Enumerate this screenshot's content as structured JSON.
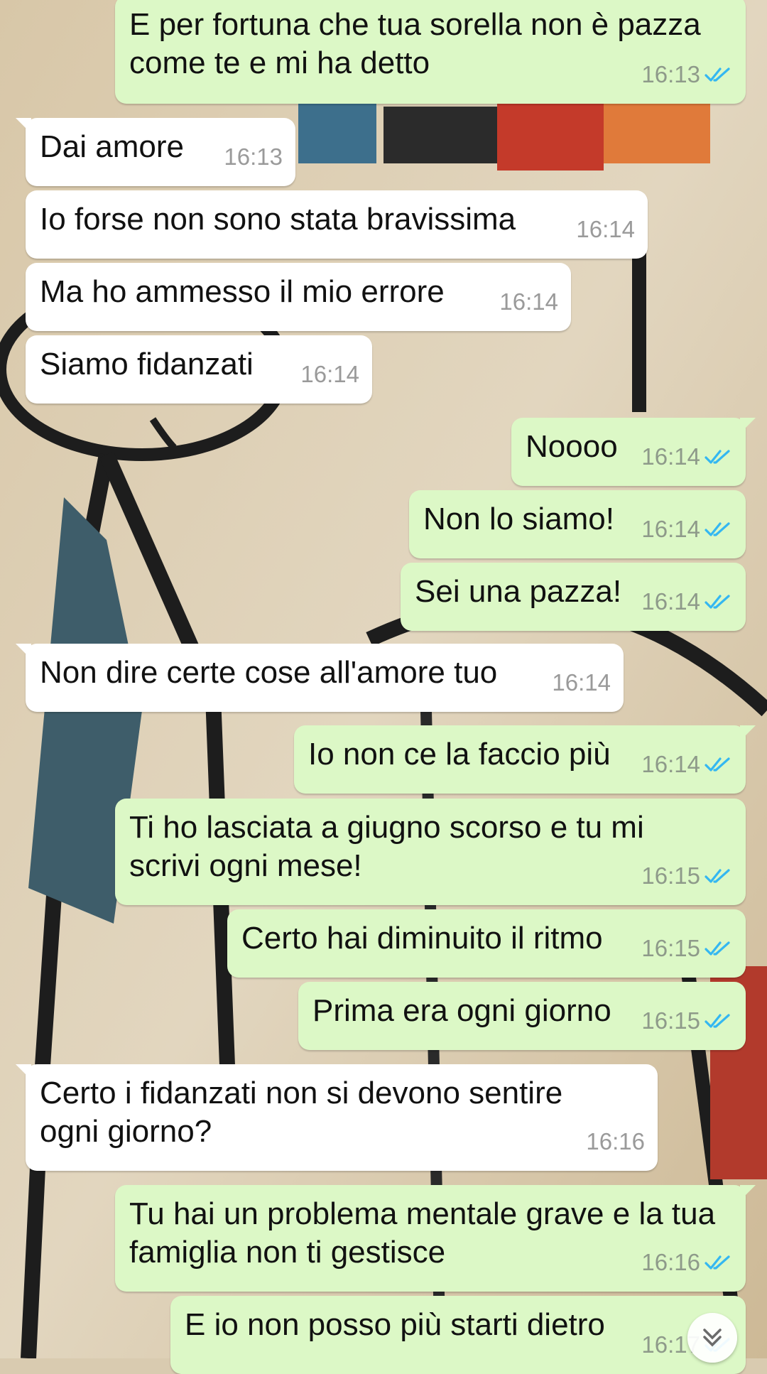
{
  "colors": {
    "outgoing_bubble": "#dcf8c6",
    "incoming_bubble": "#ffffff",
    "read_ticks": "#34b7f1",
    "time_text": "#8e9a8a"
  },
  "messages": [
    {
      "dir": "out",
      "text": "E per fortuna che tua sorella non è pazza\ncome te e mi ha detto",
      "time": "16:13",
      "status": "read"
    },
    {
      "dir": "in",
      "text": "Dai amore",
      "time": "16:13"
    },
    {
      "dir": "in",
      "text": "Io forse non sono stata bravissima",
      "time": "16:14"
    },
    {
      "dir": "in",
      "text": "Ma ho ammesso il mio errore",
      "time": "16:14"
    },
    {
      "dir": "in",
      "text": "Siamo fidanzati",
      "time": "16:14"
    },
    {
      "dir": "out",
      "text": "Noooo",
      "time": "16:14",
      "status": "read"
    },
    {
      "dir": "out",
      "text": "Non lo siamo!",
      "time": "16:14",
      "status": "read"
    },
    {
      "dir": "out",
      "text": "Sei una pazza!",
      "time": "16:14",
      "status": "read"
    },
    {
      "dir": "in",
      "text": "Non dire certe cose all'amore tuo",
      "time": "16:14"
    },
    {
      "dir": "out",
      "text": "Io non ce la faccio più",
      "time": "16:14",
      "status": "read"
    },
    {
      "dir": "out",
      "text": "Ti ho lasciata a giugno scorso e tu mi\nscrivi ogni mese!",
      "time": "16:15",
      "status": "read"
    },
    {
      "dir": "out",
      "text": "Certo hai diminuito il ritmo",
      "time": "16:15",
      "status": "read"
    },
    {
      "dir": "out",
      "text": "Prima era ogni giorno",
      "time": "16:15",
      "status": "read"
    },
    {
      "dir": "in",
      "text": "Certo i fidanzati non si devono sentire\nogni giorno?",
      "time": "16:16"
    },
    {
      "dir": "out",
      "text": "Tu hai un problema mentale grave e la tua\nfamiglia non ti gestisce",
      "time": "16:16",
      "status": "read"
    },
    {
      "dir": "out",
      "text": "E io non posso più starti dietro",
      "time": "16:17",
      "status": "read"
    }
  ],
  "icons": {
    "read_receipt": "double-check-icon",
    "scroll_down": "chevron-double-down-icon"
  }
}
